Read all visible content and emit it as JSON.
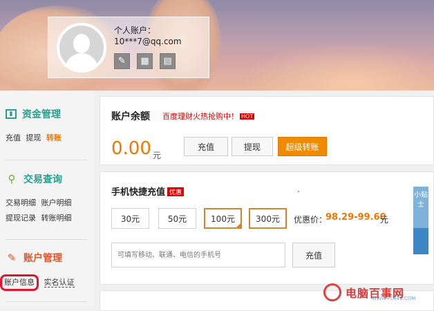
{
  "header": {
    "account_label": "个人账户：",
    "email": "10***7@qq.com",
    "icons": [
      "edit-icon",
      "calculator-icon",
      "id-card-icon"
    ]
  },
  "sidebar": {
    "funds": {
      "title": "资金管理",
      "links": [
        "充值",
        "提现",
        "转账"
      ]
    },
    "trades": {
      "title": "交易查询",
      "links": [
        "交易明细",
        "账户明细",
        "提现记录",
        "转账明细"
      ]
    },
    "account": {
      "title": "账户管理",
      "links": [
        "账户信息",
        "实名认证"
      ]
    }
  },
  "balance": {
    "label": "账户余额",
    "promo": "百度理财火热抢购中！",
    "hot_badge": "HOT",
    "amount": "0.00",
    "unit": "元",
    "buttons": {
      "recharge": "充值",
      "withdraw": "提现",
      "transfer": "超级转账"
    }
  },
  "mobile_topup": {
    "label": "手机快捷充值",
    "badge": "优惠",
    "dot": ".",
    "amounts": [
      "30元",
      "50元",
      "100元",
      "300元"
    ],
    "selected_index": 2,
    "price_label": "优惠价：",
    "price": "98.29-99.60",
    "price_unit": "元",
    "input_placeholder": "可填写移动、联通、电信的手机号",
    "submit": "充值"
  },
  "tips_tab": "小贴士",
  "watermark": {
    "text": "电脑百事网",
    "url": "WWW.PC841.COM"
  },
  "colors": {
    "accent_teal": "#2a9d8f",
    "orange": "#f07800",
    "red": "#d80000",
    "highlight_circle": "#e8112d"
  }
}
